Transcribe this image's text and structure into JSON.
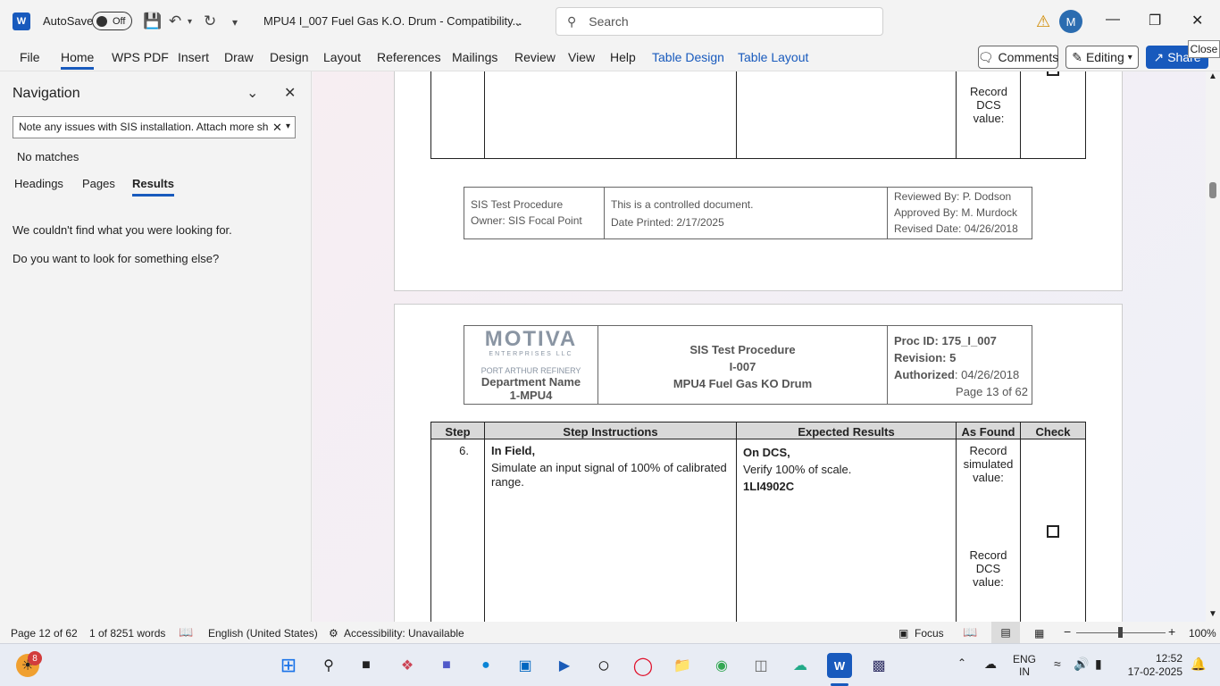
{
  "titlebar": {
    "autosave_label": "AutoSave",
    "autosave_state": "Off",
    "doc_title": "MPU4 I_007 Fuel Gas K.O. Drum  -  Compatibility...",
    "search_placeholder": "Search",
    "avatar_initial": "M",
    "close_tooltip": "Close"
  },
  "ribbon": {
    "tabs": [
      "File",
      "Home",
      "WPS PDF",
      "Insert",
      "Draw",
      "Design",
      "Layout",
      "References",
      "Mailings",
      "Review",
      "View",
      "Help",
      "Table Design",
      "Table Layout"
    ],
    "comments_label": "Comments",
    "editing_label": "Editing",
    "share_label": "Share"
  },
  "navigation": {
    "title": "Navigation",
    "search_value": "Note any issues with SIS installation. Attach more sh",
    "no_matches": "No matches",
    "tabs": [
      "Headings",
      "Pages",
      "Results"
    ],
    "msg1": "We couldn't find what you were looking for.",
    "msg2": "Do you want to look for something else?"
  },
  "page_top": {
    "as_found_lines": [
      "Record",
      "DCS",
      "value:"
    ],
    "footer": {
      "col1": [
        "SIS Test Procedure",
        "Owner: SIS Focal Point"
      ],
      "col2": [
        "This is a controlled document.",
        "Date Printed: 2/17/2025"
      ],
      "col3": [
        "Reviewed By: P. Dodson",
        "Approved By: M. Murdock",
        "Revised Date: 04/26/2018"
      ]
    }
  },
  "page_bottom": {
    "header": {
      "logo": "MOTIVA",
      "logo_sub": "ENTERPRISES LLC",
      "refinery": "PORT ARTHUR REFINERY",
      "dept1": "Department Name",
      "dept2": "1-MPU4",
      "center1": "SIS Test Procedure",
      "center2": "I-007",
      "center3": "MPU4 Fuel Gas KO Drum",
      "proc_id": "Proc ID: 175_I_007",
      "revision": "Revision: 5",
      "authorized_label": "Authorized",
      "authorized_value": ": 04/26/2018",
      "page_of": "Page 13 of 62"
    },
    "table": {
      "headers": [
        "Step",
        "Step Instructions",
        "Expected Results",
        "As Found",
        "Check"
      ],
      "step": "6.",
      "instr_bold": "In Field,",
      "instr_text": "Simulate an input signal of 100% of calibrated range.",
      "exp_bold": "On DCS,",
      "exp_text": "Verify 100% of scale.",
      "exp_tag": "1LI4902C",
      "as_found_1": [
        "Record",
        "simulated",
        "value:"
      ],
      "as_found_2": [
        "Record",
        "DCS",
        "value:"
      ]
    }
  },
  "statusbar": {
    "page": "Page 12 of 62",
    "words": "1 of 8251 words",
    "language": "English (United States)",
    "accessibility": "Accessibility: Unavailable",
    "focus": "Focus",
    "zoom": "100%"
  },
  "taskbar": {
    "weather_badge": "8",
    "lang1": "ENG",
    "lang2": "IN",
    "time": "12:52",
    "date": "17-02-2025"
  }
}
